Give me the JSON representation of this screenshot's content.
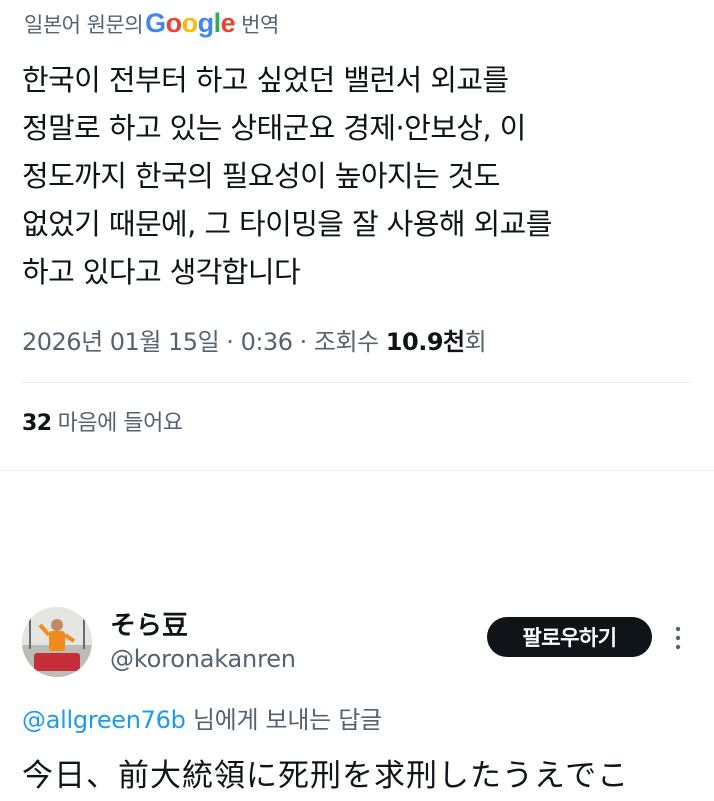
{
  "translation": {
    "prefix": "일본어 원문의",
    "google_letters": [
      "G",
      "o",
      "o",
      "g",
      "l",
      "e"
    ],
    "suffix": "번역"
  },
  "tweet": {
    "text": "한국이 전부터 하고 싶었던 밸런서 외교를\n정말로 하고 있는 상태군요 경제·안보상, 이\n정도까지 한국의 필요성이 높아지는 것도\n없었기 때문에, 그 타이밍을 잘 사용해 외교를\n하고 있다고 생각합니다",
    "date": "2026년 01월 15일",
    "separator": "·",
    "time": "0:36",
    "views_label": "조회수",
    "views_count": "10.9천",
    "views_suffix": "회",
    "likes_count": "32",
    "likes_label": "마음에 들어요"
  },
  "reply": {
    "display_name": "そら豆",
    "handle": "@koronakanren",
    "follow_label": "팔로우하기",
    "more_icon": "more-vertical-icon",
    "reply_to_mention": "@allgreen76b",
    "reply_to_suffix": "님에게 보내는 답글",
    "text": "今日、前大統領に死刑を求刑したうえでこ"
  },
  "colors": {
    "text_primary": "#0f1419",
    "text_secondary": "#536471",
    "link": "#1d9bf0",
    "google_blue": "#4285f4",
    "google_red": "#ea4335",
    "google_yellow": "#fbbc05",
    "google_green": "#34a853",
    "button_bg": "#0f1419",
    "button_text": "#ffffff"
  }
}
